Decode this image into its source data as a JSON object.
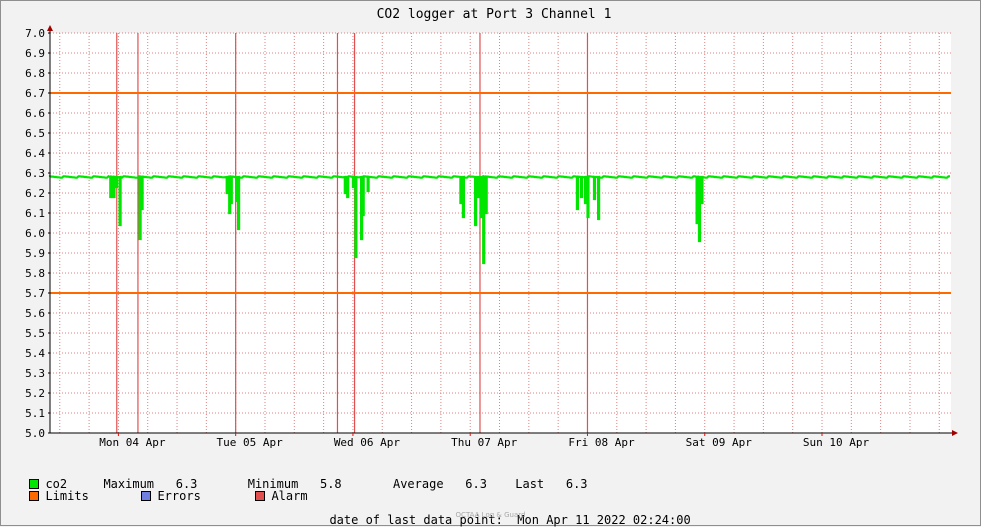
{
  "chart_data": {
    "type": "line",
    "title": "CO2 logger at Port 3 Channel 1",
    "ylim": [
      5.0,
      7.0
    ],
    "yticks": [
      "5.0",
      "5.1",
      "5.2",
      "5.3",
      "5.4",
      "5.5",
      "5.6",
      "5.7",
      "5.8",
      "5.9",
      "6.0",
      "6.1",
      "6.2",
      "6.3",
      "6.4",
      "6.5",
      "6.6",
      "6.7",
      "6.8",
      "6.9",
      "7.0"
    ],
    "xlim": [
      "2022-04-03 10:00",
      "2022-04-11 02:24"
    ],
    "x_ticks": [
      {
        "label": "Mon 04 Apr",
        "t": "2022-04-04 00:00"
      },
      {
        "label": "Tue 05 Apr",
        "t": "2022-04-05 00:00"
      },
      {
        "label": "Wed 06 Apr",
        "t": "2022-04-06 00:00"
      },
      {
        "label": "Thu 07 Apr",
        "t": "2022-04-07 00:00"
      },
      {
        "label": "Fri 08 Apr",
        "t": "2022-04-08 00:00"
      },
      {
        "label": "Sat 09 Apr",
        "t": "2022-04-09 00:00"
      },
      {
        "label": "Sun 10 Apr",
        "t": "2022-04-10 00:00"
      }
    ],
    "limits": [
      6.7,
      5.7
    ],
    "alarms": [
      "2022-04-03 23:40",
      "2022-04-04 04:00",
      "2022-04-05 00:00",
      "2022-04-05 20:50",
      "2022-04-06 00:20",
      "2022-04-07 02:00",
      "2022-04-08 00:00"
    ],
    "series": [
      {
        "name": "co2",
        "baseline": 6.28,
        "dips": [
          {
            "t": "2022-04-03 22:20",
            "v": 6.18
          },
          {
            "t": "2022-04-03 23:00",
            "v": 6.18
          },
          {
            "t": "2022-04-03 23:30",
            "v": 6.23
          },
          {
            "t": "2022-04-04 00:15",
            "v": 6.04
          },
          {
            "t": "2022-04-04 04:20",
            "v": 5.97
          },
          {
            "t": "2022-04-04 04:45",
            "v": 6.12
          },
          {
            "t": "2022-04-04 22:10",
            "v": 6.2
          },
          {
            "t": "2022-04-04 22:40",
            "v": 6.1
          },
          {
            "t": "2022-04-04 23:00",
            "v": 6.15
          },
          {
            "t": "2022-04-05 00:10",
            "v": 6.16
          },
          {
            "t": "2022-04-05 00:30",
            "v": 6.02
          },
          {
            "t": "2022-04-05 22:20",
            "v": 6.2
          },
          {
            "t": "2022-04-05 22:50",
            "v": 6.18
          },
          {
            "t": "2022-04-06 00:00",
            "v": 6.23
          },
          {
            "t": "2022-04-06 00:30",
            "v": 5.88
          },
          {
            "t": "2022-04-06 01:40",
            "v": 5.97
          },
          {
            "t": "2022-04-06 02:00",
            "v": 6.09
          },
          {
            "t": "2022-04-06 03:00",
            "v": 6.21
          },
          {
            "t": "2022-04-06 22:00",
            "v": 6.15
          },
          {
            "t": "2022-04-06 22:30",
            "v": 6.08
          },
          {
            "t": "2022-04-07 01:00",
            "v": 6.04
          },
          {
            "t": "2022-04-07 01:40",
            "v": 6.18
          },
          {
            "t": "2022-04-07 02:10",
            "v": 6.08
          },
          {
            "t": "2022-04-07 02:40",
            "v": 5.85
          },
          {
            "t": "2022-04-07 03:10",
            "v": 6.1
          },
          {
            "t": "2022-04-07 21:50",
            "v": 6.12
          },
          {
            "t": "2022-04-07 22:40",
            "v": 6.18
          },
          {
            "t": "2022-04-07 23:30",
            "v": 6.15
          },
          {
            "t": "2022-04-08 00:00",
            "v": 6.08
          },
          {
            "t": "2022-04-08 01:20",
            "v": 6.17
          },
          {
            "t": "2022-04-08 02:10",
            "v": 6.07
          },
          {
            "t": "2022-04-08 22:20",
            "v": 6.05
          },
          {
            "t": "2022-04-08 22:50",
            "v": 5.96
          },
          {
            "t": "2022-04-08 23:20",
            "v": 6.15
          }
        ]
      }
    ]
  },
  "legend": {
    "series_label": "co2",
    "maximum_label": "Maximum",
    "maximum_value": "6.3",
    "minimum_label": "Minimum",
    "minimum_value": "5.8",
    "average_label": "Average",
    "average_value": "6.3",
    "last_label": "Last",
    "last_value": "6.3",
    "limits_label": "Limits",
    "errors_label": "Errors",
    "alarm_label": "Alarm"
  },
  "footer": {
    "last_point_label": "date of last data point:",
    "last_point_value": "Mon Apr 11 2022 02:24:00",
    "watermark": "OCTAA Log & Guard"
  },
  "colors": {
    "series": "#00e600",
    "limits": "#ff6a00",
    "alarm": "#e05050",
    "errors": "#7080e0",
    "grid": "#e08080"
  }
}
